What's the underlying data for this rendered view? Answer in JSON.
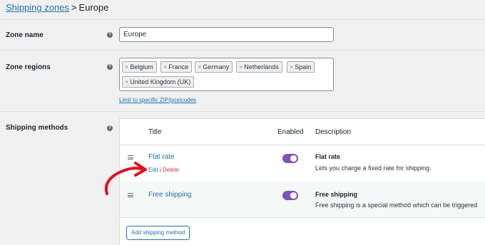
{
  "breadcrumb": {
    "link": "Shipping zones",
    "separator": ">",
    "current": "Europe"
  },
  "zone_name": {
    "label": "Zone name",
    "help": "?",
    "value": "Europe"
  },
  "zone_regions": {
    "label": "Zone regions",
    "help": "?",
    "remove_glyph": "×",
    "tokens": [
      "Belgium",
      "France",
      "Germany",
      "Netherlands",
      "Spain",
      "United Kingdom (UK)"
    ],
    "limit_link": "Limit to specific ZIP/postcodes"
  },
  "shipping_methods": {
    "label": "Shipping methods",
    "help": "?",
    "columns": {
      "title": "Title",
      "enabled": "Enabled",
      "description": "Description"
    },
    "methods": [
      {
        "title": "Flat rate",
        "edit": "Edit",
        "pipe": "|",
        "delete": "Delete",
        "enabled": true,
        "desc_title": "Flat rate",
        "desc": "Lets you charge a fixed rate for shipping."
      },
      {
        "title": "Free shipping",
        "enabled": true,
        "desc_title": "Free shipping",
        "desc": "Free shipping is a special method which can be triggered"
      }
    ],
    "add_button": "Add shipping method"
  },
  "colors": {
    "link": "#2271b1",
    "delete": "#d63638",
    "toggle_on": "#7f54b3",
    "annotation_arrow": "#e0101c"
  }
}
